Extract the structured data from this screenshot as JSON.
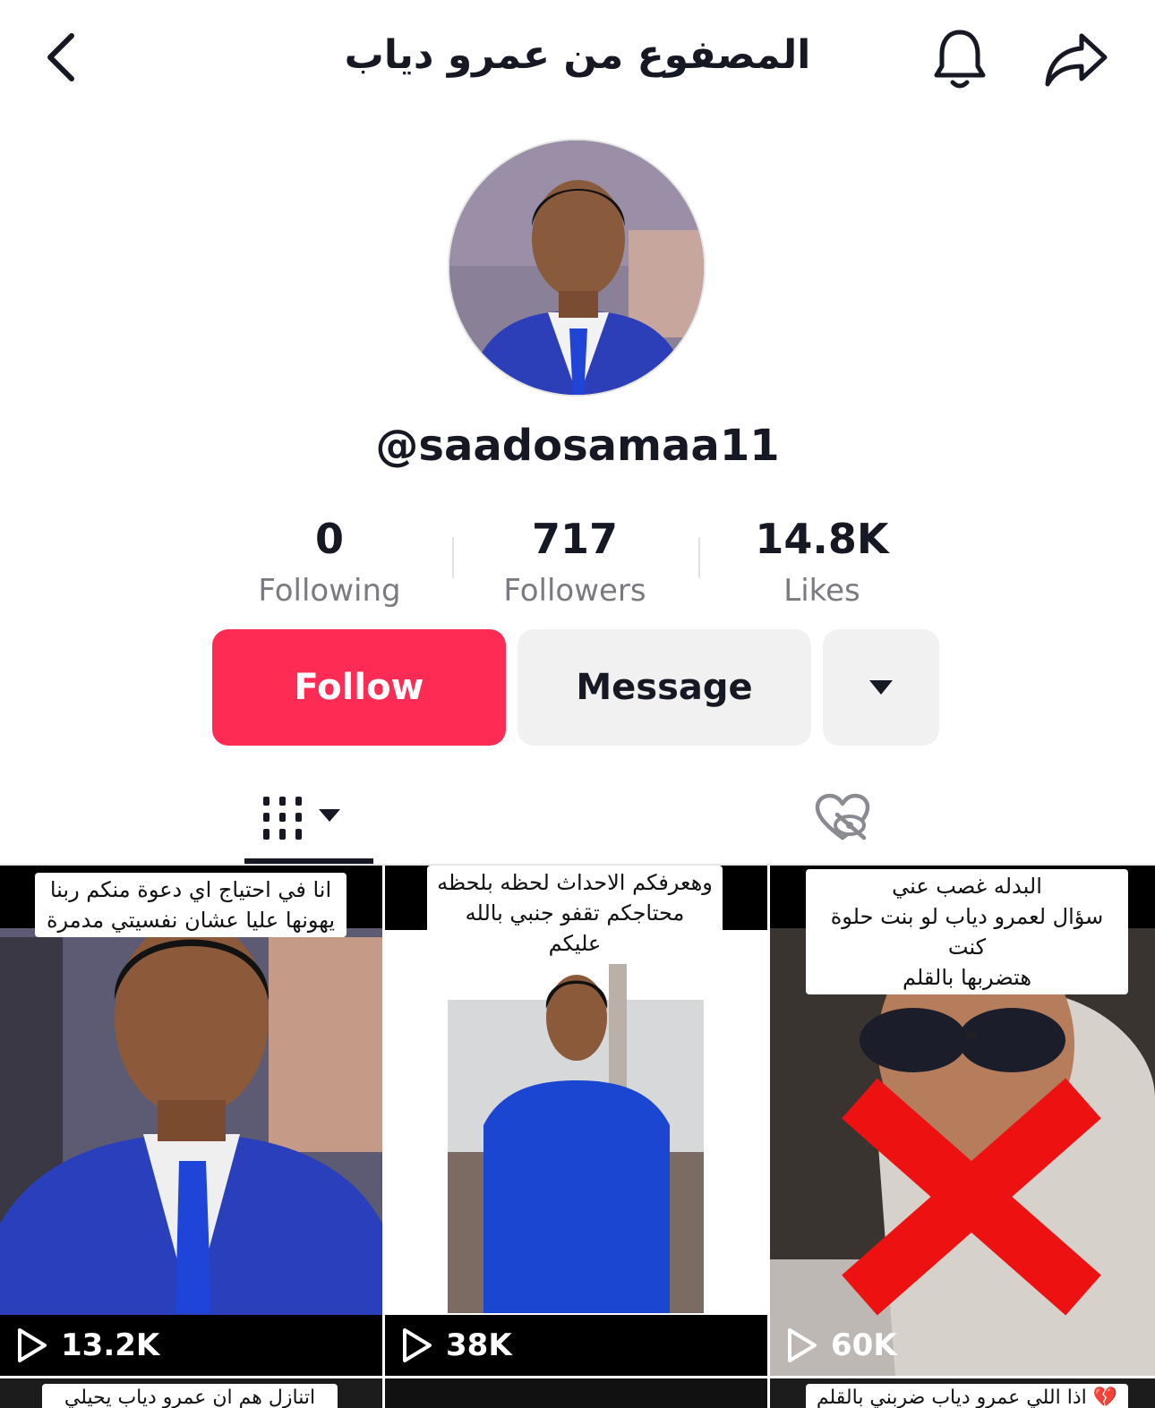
{
  "header": {
    "title": "المصفوع من عمرو دياب",
    "back_icon": "chevron-left-icon",
    "bell_icon": "bell-icon",
    "share_icon": "share-arrow-icon"
  },
  "profile": {
    "username": "@saadosamaa11",
    "stats": [
      {
        "value": "0",
        "label": "Following"
      },
      {
        "value": "717",
        "label": "Followers"
      },
      {
        "value": "14.8K",
        "label": "Likes"
      }
    ]
  },
  "actions": {
    "follow_label": "Follow",
    "message_label": "Message",
    "more_icon": "caret-down-icon"
  },
  "tabs": {
    "videos_icon": "videos-grid-icon",
    "liked_icon": "liked-hidden-icon"
  },
  "colors": {
    "accent": "#fe2c55",
    "secondary_button": "#f1f1f2",
    "text": "#161823",
    "muted": "#7a7b80"
  },
  "videos": [
    {
      "caption_1": "انا في احتياج اي دعوة منكم ربنا",
      "caption_2": "يهونها عليا عشان نفسيتي مدمرة",
      "views": "13.2K"
    },
    {
      "caption_1": "وهعرفكم الاحداث لحظه بلحظه",
      "caption_2": "محتاجكم تقفو جنبي بالله عليكم",
      "views": "38K"
    },
    {
      "caption_1": "البدله غصب عني",
      "caption_2": "سؤال لعمرو دياب لو بنت حلوة كنت",
      "caption_3": "هتضربها بالقلم",
      "views": "60K"
    },
    {
      "caption_1": "اتنازل هم ان عمرو دياب يحيلي"
    },
    {},
    {
      "caption_1": "💔 اذا اللي عمرو دياب ضربني بالقلم"
    }
  ]
}
